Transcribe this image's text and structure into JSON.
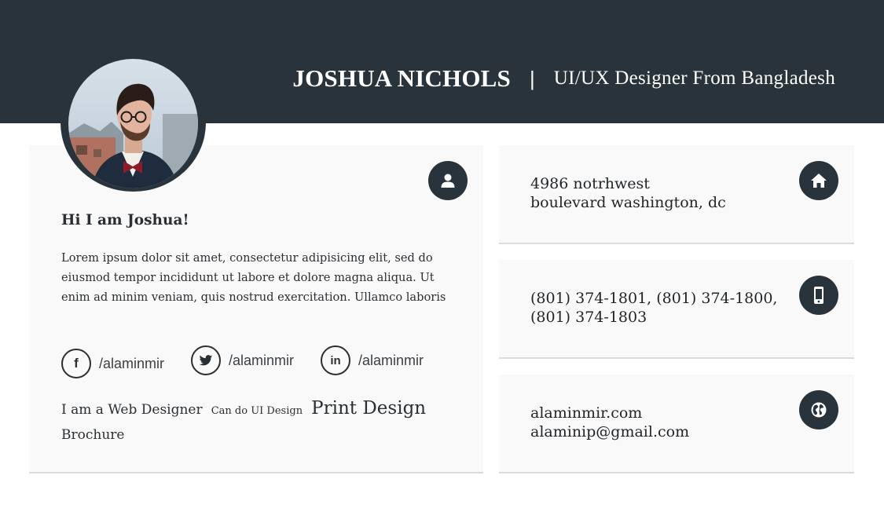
{
  "header": {
    "name": "JOSHUA NICHOLS",
    "separator": "|",
    "role": "UI/UX Designer From Bangladesh"
  },
  "profile": {
    "greeting": "Hi I am Joshua!",
    "bio": "Lorem ipsum dolor sit amet, consectetur adipisicing elit, sed do eiusmod tempor incididunt ut labore et dolore magna aliqua. Ut enim ad minim veniam, quis nostrud exercitation. Ullamco laboris",
    "badge_icon": "user-icon",
    "social": [
      {
        "icon": "facebook-icon",
        "glyph": "f",
        "handle": "/alaminmir"
      },
      {
        "icon": "twitter-icon",
        "glyph": "",
        "handle": "/alaminmir"
      },
      {
        "icon": "linkedin-icon",
        "glyph": "in",
        "handle": "/alaminmir"
      }
    ],
    "tags": [
      "I am a Web Designer",
      "Can do UI Design",
      "Print Design",
      "Brochure"
    ]
  },
  "contact": {
    "address": {
      "icon": "home-icon",
      "line1": "4986 notrhwest",
      "line2": "boulevard washington, dc"
    },
    "phone": {
      "icon": "phone-icon",
      "line1": "(801) 374-1801, (801) 374-1800,",
      "line2": "(801) 374-1803"
    },
    "web": {
      "icon": "globe-icon",
      "line1": "alaminmir.com",
      "line2": "alaminip@gmail.com"
    }
  },
  "colors": {
    "header_bg": "#29333b",
    "card_bg": "#f9f9f9",
    "text": "#2a2f33",
    "accent": "#8e1b2c"
  }
}
